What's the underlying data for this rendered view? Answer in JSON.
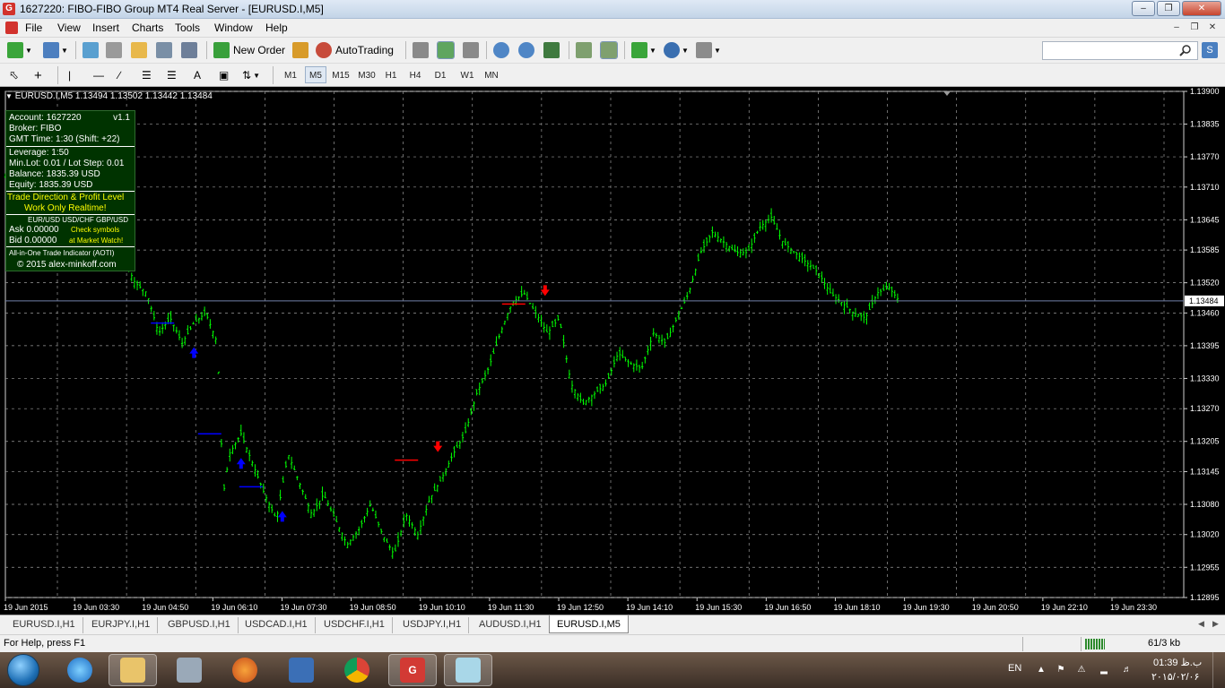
{
  "window": {
    "title": "1627220: FIBO-FIBO Group MT4 Real Server - [EURUSD.I,M5]",
    "app_icon": "G",
    "buttons": [
      "minimize-icon",
      "restore-icon",
      "close-icon"
    ]
  },
  "menu": {
    "items": [
      "File",
      "View",
      "Insert",
      "Charts",
      "Tools",
      "Window",
      "Help"
    ]
  },
  "toolbar": {
    "new_order": "New Order",
    "autotrading": "AutoTrading",
    "search_placeholder": ""
  },
  "timeframes": {
    "items": [
      "M1",
      "M5",
      "M15",
      "M30",
      "H1",
      "H4",
      "D1",
      "W1",
      "MN"
    ],
    "active": "M5"
  },
  "chart": {
    "symbol_line": "EURUSD.I,M5  1.13494 1.13502 1.13442 1.13484",
    "current_price_label": "1.13484",
    "colors": {
      "background": "#000000",
      "grid": "#9a9a9a",
      "candles": "#00ff00",
      "buy_arrow": "#0000ff",
      "sell_arrow": "#ff0000",
      "price_line": "#6f7fa8"
    }
  },
  "info_panel": {
    "account": "Account: 1627220",
    "version": "v1.1",
    "broker": "Broker: FIBO",
    "gmt": "GMT Time: 1:30 (Shift: +22)",
    "leverage": "Leverage: 1:50",
    "minlot": "Min.Lot: 0.01 / Lot Step: 0.01",
    "balance": "Balance: 1835.39 USD",
    "equity": "Equity:     1835.39 USD",
    "trade_direction": "Trade Direction & Profit Level",
    "realtime": "Work Only Realtime!",
    "symbols_header": "EUR/USD   USD/CHF   GBP/USD",
    "ask": "Ask 0.00000",
    "bid": "Bid  0.00000",
    "check_symbols": "Check symbols",
    "at_market_watch": "at Market Watch!",
    "indicator_name": "All-in-One Trade Indicator (AOTI)",
    "copyright": "© 2015  alex-minkoff.com"
  },
  "chart_data": {
    "type": "candlestick",
    "symbol": "EURUSD.I",
    "timeframe": "M5",
    "title": "EURUSD.I,M5",
    "ohlc_last": {
      "open": 1.13494,
      "high": 1.13502,
      "low": 1.13442,
      "close": 1.13484
    },
    "y_ticks": [
      "1.13900",
      "1.13835",
      "1.13770",
      "1.13710",
      "1.13645",
      "1.13585",
      "1.13520",
      "1.13460",
      "1.13395",
      "1.13330",
      "1.13270",
      "1.13205",
      "1.13145",
      "1.13080",
      "1.13020",
      "1.12955",
      "1.12895"
    ],
    "x_ticks": [
      "19 Jun 2015",
      "19 Jun 03:30",
      "19 Jun 04:50",
      "19 Jun 06:10",
      "19 Jun 07:30",
      "19 Jun 08:50",
      "19 Jun 10:10",
      "19 Jun 11:30",
      "19 Jun 12:50",
      "19 Jun 14:10",
      "19 Jun 15:30",
      "19 Jun 16:50",
      "19 Jun 18:10",
      "19 Jun 19:30",
      "19 Jun 20:50",
      "19 Jun 22:10",
      "19 Jun 23:30"
    ],
    "ylim": [
      1.12895,
      1.139
    ],
    "current_price": 1.13484,
    "close_path": [
      [
        0.0,
        1.1373
      ],
      [
        0.03,
        1.1375
      ],
      [
        0.05,
        1.1372
      ],
      [
        0.07,
        1.137
      ],
      [
        0.08,
        1.1364
      ],
      [
        0.09,
        1.1362
      ],
      [
        0.1,
        1.1357
      ],
      [
        0.11,
        1.1352
      ],
      [
        0.12,
        1.135
      ],
      [
        0.13,
        1.1342
      ],
      [
        0.14,
        1.1345
      ],
      [
        0.15,
        1.134
      ],
      [
        0.16,
        1.1344
      ],
      [
        0.17,
        1.1346
      ],
      [
        0.18,
        1.134
      ],
      [
        0.185,
        1.131
      ],
      [
        0.19,
        1.1318
      ],
      [
        0.2,
        1.1322
      ],
      [
        0.21,
        1.1316
      ],
      [
        0.22,
        1.131
      ],
      [
        0.23,
        1.1305
      ],
      [
        0.24,
        1.1318
      ],
      [
        0.25,
        1.1312
      ],
      [
        0.26,
        1.1306
      ],
      [
        0.27,
        1.131
      ],
      [
        0.28,
        1.1305
      ],
      [
        0.29,
        1.13
      ],
      [
        0.3,
        1.1303
      ],
      [
        0.31,
        1.1308
      ],
      [
        0.32,
        1.1302
      ],
      [
        0.33,
        1.1298
      ],
      [
        0.34,
        1.1306
      ],
      [
        0.35,
        1.1302
      ],
      [
        0.36,
        1.1309
      ],
      [
        0.37,
        1.1313
      ],
      [
        0.38,
        1.1318
      ],
      [
        0.39,
        1.1322
      ],
      [
        0.4,
        1.133
      ],
      [
        0.41,
        1.1335
      ],
      [
        0.42,
        1.1342
      ],
      [
        0.43,
        1.1348
      ],
      [
        0.44,
        1.135
      ],
      [
        0.45,
        1.1346
      ],
      [
        0.46,
        1.1342
      ],
      [
        0.47,
        1.1345
      ],
      [
        0.48,
        1.1332
      ],
      [
        0.49,
        1.1328
      ],
      [
        0.5,
        1.133
      ],
      [
        0.51,
        1.1332
      ],
      [
        0.52,
        1.1338
      ],
      [
        0.53,
        1.1336
      ],
      [
        0.54,
        1.1335
      ],
      [
        0.55,
        1.1342
      ],
      [
        0.56,
        1.134
      ],
      [
        0.57,
        1.1345
      ],
      [
        0.58,
        1.135
      ],
      [
        0.59,
        1.1358
      ],
      [
        0.6,
        1.1362
      ],
      [
        0.61,
        1.136
      ],
      [
        0.62,
        1.1358
      ],
      [
        0.63,
        1.1358
      ],
      [
        0.64,
        1.1363
      ],
      [
        0.65,
        1.1365
      ],
      [
        0.66,
        1.136
      ],
      [
        0.67,
        1.1358
      ],
      [
        0.68,
        1.1356
      ],
      [
        0.69,
        1.1354
      ],
      [
        0.7,
        1.135
      ],
      [
        0.71,
        1.1348
      ],
      [
        0.72,
        1.1346
      ],
      [
        0.73,
        1.1345
      ],
      [
        0.74,
        1.135
      ],
      [
        0.75,
        1.1351
      ],
      [
        0.76,
        1.1348
      ]
    ],
    "buy_signals": [
      0.16,
      0.2,
      0.235
    ],
    "sell_signals": [
      0.367,
      0.458
    ],
    "grid": true
  },
  "tabs": {
    "items": [
      "EURUSD.I,H1",
      "EURJPY.I,H1",
      "GBPUSD.I,H1",
      "USDCAD.I,H1",
      "USDCHF.I,H1",
      "USDJPY.I,H1",
      "AUDUSD.I,H1",
      "EURUSD.I,M5"
    ],
    "active": "EURUSD.I,M5"
  },
  "status": {
    "help": "For Help, press F1",
    "traffic": "61/3 kb"
  },
  "taskbar": {
    "apps": [
      "start-orb",
      "internet-explorer-icon",
      "explorer-folder-icon",
      "calculator-icon",
      "firefox-icon",
      "remote-desktop-icon",
      "chrome-icon",
      "mt4-fibo-icon",
      "notepad-icon"
    ],
    "lang": "EN",
    "time": "01:39 ب.ظ",
    "date": "۲۰۱۵/۰۲/۰۶"
  }
}
